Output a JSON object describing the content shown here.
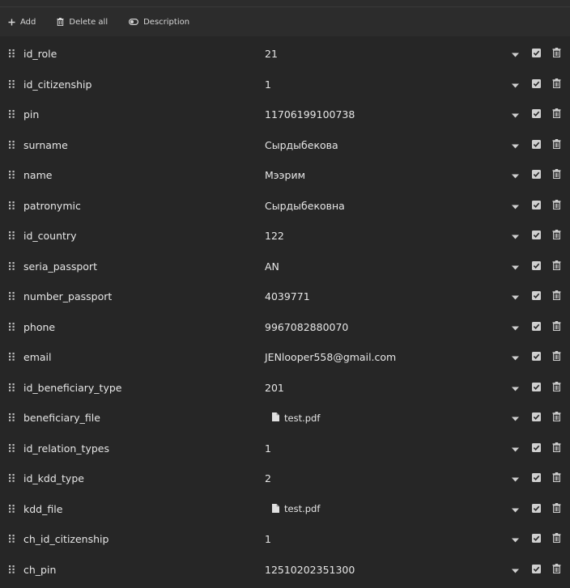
{
  "toolbar": {
    "add_label": "Add",
    "delete_all_label": "Delete all",
    "description_label": "Description"
  },
  "rows": [
    {
      "key": "id_role",
      "value": "21",
      "type": "text"
    },
    {
      "key": "id_citizenship",
      "value": "1",
      "type": "text"
    },
    {
      "key": "pin",
      "value": "11706199100738",
      "type": "text"
    },
    {
      "key": "surname",
      "value": "Сырдыбекова",
      "type": "text"
    },
    {
      "key": "name",
      "value": "Мээрим",
      "type": "text"
    },
    {
      "key": "patronymic",
      "value": "Сырдыбековна",
      "type": "text"
    },
    {
      "key": "id_country",
      "value": "122",
      "type": "text"
    },
    {
      "key": "seria_passport",
      "value": "AN",
      "type": "text"
    },
    {
      "key": "number_passport",
      "value": "4039771",
      "type": "text"
    },
    {
      "key": "phone",
      "value": "9967082880070",
      "type": "text"
    },
    {
      "key": "email",
      "value": "JENlooper558@gmail.com",
      "type": "text"
    },
    {
      "key": "id_beneficiary_type",
      "value": "201",
      "type": "text"
    },
    {
      "key": "beneficiary_file",
      "value": "test.pdf",
      "type": "file"
    },
    {
      "key": "id_relation_types",
      "value": "1",
      "type": "text"
    },
    {
      "key": "id_kdd_type",
      "value": "2",
      "type": "text"
    },
    {
      "key": "kdd_file",
      "value": "test.pdf",
      "type": "file"
    },
    {
      "key": "ch_id_citizenship",
      "value": "1",
      "type": "text"
    },
    {
      "key": "ch_pin",
      "value": "12510202351300",
      "type": "text"
    }
  ],
  "icons": {
    "drag": "drag-handle-icon",
    "caret": "chevron-down-icon",
    "check": "checkbox-checked-icon",
    "trash": "trash-icon",
    "file": "file-icon"
  },
  "colors": {
    "background": "#262626",
    "toolbar": "#2c2c2c",
    "text": "#e6e6e6",
    "icon": "#d0d0d0"
  }
}
